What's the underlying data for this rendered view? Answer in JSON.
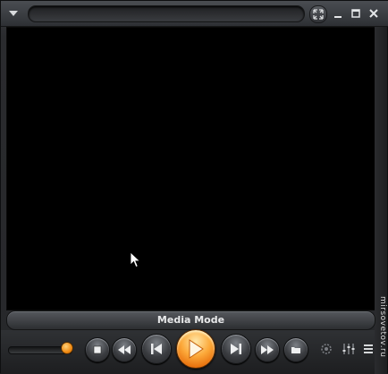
{
  "window": {
    "title": "",
    "mode_label": "Media Mode"
  },
  "watermark": "mirsovetov.ru",
  "icons": {
    "menu": "menu-triangle-icon",
    "expand": "expand-icon",
    "minimize": "minimize-icon",
    "maximize": "maximize-icon",
    "close": "close-icon",
    "stop": "stop-icon",
    "rewind": "rewind-icon",
    "previous": "previous-track-icon",
    "play": "play-icon",
    "next": "next-track-icon",
    "forward": "fast-forward-icon",
    "open": "open-file-icon",
    "settings": "settings-icon",
    "equalizer": "equalizer-icon",
    "playlist": "playlist-icon"
  },
  "volume": {
    "level": 0.85
  },
  "colors": {
    "accent": "#f39a22",
    "video_bg": "#000000"
  }
}
